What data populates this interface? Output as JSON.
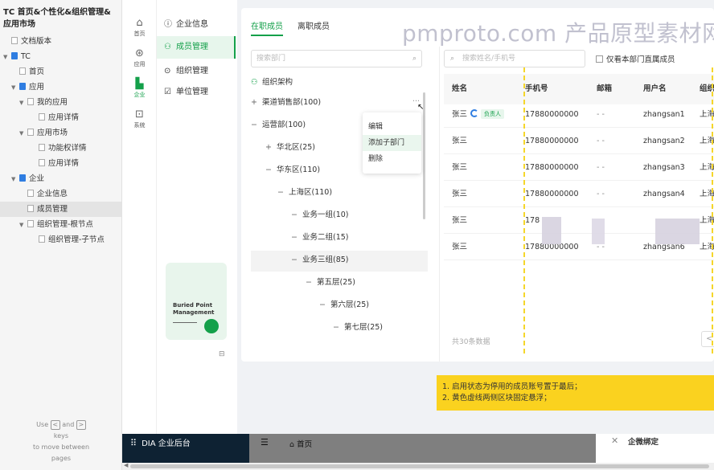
{
  "project": {
    "title": "TC 首页&个性化&组织管理&应用市场",
    "pages": [
      {
        "label": "文档版本",
        "icon": "page",
        "level": 0,
        "arrow": ""
      },
      {
        "label": "TC",
        "icon": "folder",
        "level": 0,
        "arrow": "▼"
      },
      {
        "label": "首页",
        "icon": "page",
        "level": 1,
        "arrow": ""
      },
      {
        "label": "应用",
        "icon": "folder",
        "level": 1,
        "arrow": "▼"
      },
      {
        "label": "我的应用",
        "icon": "page",
        "level": 2,
        "arrow": "▼"
      },
      {
        "label": "应用详情",
        "icon": "page",
        "level": 3,
        "arrow": ""
      },
      {
        "label": "应用市场",
        "icon": "page",
        "level": 2,
        "arrow": "▼"
      },
      {
        "label": "功能权详情",
        "icon": "page",
        "level": 3,
        "arrow": ""
      },
      {
        "label": "应用详情",
        "icon": "page",
        "level": 3,
        "arrow": ""
      },
      {
        "label": "企业",
        "icon": "folder",
        "level": 1,
        "arrow": "▼"
      },
      {
        "label": "企业信息",
        "icon": "page",
        "level": 2,
        "arrow": ""
      },
      {
        "label": "成员管理",
        "icon": "page",
        "level": 2,
        "arrow": "",
        "selected": true
      },
      {
        "label": "组织管理-根节点",
        "icon": "page",
        "level": 2,
        "arrow": "▼"
      },
      {
        "label": "组织管理-子节点",
        "icon": "page",
        "level": 3,
        "arrow": ""
      }
    ],
    "hint": {
      "use": "Use",
      "and": "and",
      "keys": "keys",
      "line3": "to move between",
      "line4": "pages",
      "left_key": "<",
      "right_key": ">"
    }
  },
  "rail": [
    {
      "label": "首页",
      "icon": "home-icon",
      "glyph": "⌂"
    },
    {
      "label": "应用",
      "icon": "apps-icon",
      "glyph": "⊛"
    },
    {
      "label": "企业",
      "icon": "enterprise-icon",
      "glyph": "▙",
      "active": true
    },
    {
      "label": "系统",
      "icon": "system-icon",
      "glyph": "⊡"
    }
  ],
  "submenu": [
    {
      "label": "企业信息",
      "glyph": "ⓘ"
    },
    {
      "label": "成员管理",
      "glyph": "⚇",
      "active": true
    },
    {
      "label": "组织管理",
      "glyph": "⊙"
    },
    {
      "label": "单位管理",
      "glyph": "☑"
    }
  ],
  "promo": {
    "line1": "Buried Point",
    "line2": "Management"
  },
  "tabs": [
    {
      "label": "在职成员",
      "active": true
    },
    {
      "label": "离职成员",
      "active": false
    }
  ],
  "watermark": "pmproto.com 产品原型素材网站",
  "dept": {
    "search_placeholder": "搜索部门",
    "root": "组织架构",
    "nodes": [
      {
        "label": "渠道销售部(100)",
        "toggle": "+"
      },
      {
        "label": "运营部(100)",
        "toggle": "−"
      },
      {
        "label": "华北区(25)",
        "toggle": "+"
      },
      {
        "label": "华东区(110)",
        "toggle": "−"
      },
      {
        "label": "上海区(110)",
        "toggle": "−"
      },
      {
        "label": "业务一组(10)",
        "toggle": "−"
      },
      {
        "label": "业务二组(15)",
        "toggle": "−"
      },
      {
        "label": "业务三组(85)",
        "toggle": "−"
      },
      {
        "label": "第五层(25)",
        "toggle": "−"
      },
      {
        "label": "第六层(25)",
        "toggle": "−"
      },
      {
        "label": "第七层(25)",
        "toggle": "−"
      }
    ],
    "more": "···",
    "context_menu": [
      "编辑",
      "添加子部门",
      "删除"
    ]
  },
  "members": {
    "search_placeholder": "搜索姓名/手机号",
    "only_direct": "仅看本部门直属成员",
    "columns": [
      "姓名",
      "手机号",
      "邮箱",
      "用户名",
      "组织"
    ],
    "rows": [
      {
        "name": "张三",
        "phone": "17880000000",
        "email": "- -",
        "user": "zhangsan1",
        "org": "上海",
        "badge": "负责人"
      },
      {
        "name": "张三",
        "phone": "17880000000",
        "email": "- -",
        "user": "zhangsan2",
        "org": "上海"
      },
      {
        "name": "张三",
        "phone": "17880000000",
        "email": "- -",
        "user": "zhangsan3",
        "org": "上海"
      },
      {
        "name": "张三",
        "phone": "17880000000",
        "email": "- -",
        "user": "zhangsan4",
        "org": "上海"
      },
      {
        "name": "张三",
        "phone": "178",
        "email": "",
        "user": "",
        "org": "上海"
      },
      {
        "name": "张三",
        "phone": "17880000000",
        "email": "- -",
        "user": "zhangsan6",
        "org": "上海"
      }
    ],
    "total": "共30条数据",
    "pager_prev": "<"
  },
  "note": {
    "line1": "1. 启用状态为停用的成员账号置于最后；",
    "line2": "2. 黄色虚线两侧区块固定悬浮；"
  },
  "bottom": {
    "brand": "DIA 企业后台",
    "home": "首页",
    "drawer_title": "企微绑定"
  }
}
